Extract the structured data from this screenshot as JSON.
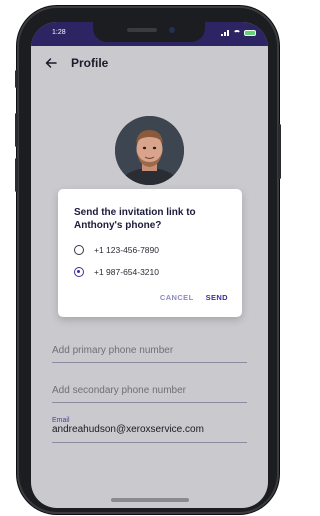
{
  "status": {
    "time": "1:28"
  },
  "header": {
    "title": "Profile"
  },
  "fields": {
    "primary_placeholder": "Add primary phone number",
    "secondary_placeholder": "Add secondary phone number",
    "email_label": "Email",
    "email_value": "andreahudson@xeroxservice.com"
  },
  "dialog": {
    "title": "Send the invitation link to Anthony's phone?",
    "options": [
      {
        "label": "+1 123-456-7890",
        "selected": false
      },
      {
        "label": "+1 987-654-3210",
        "selected": true
      }
    ],
    "cancel_label": "CANCEL",
    "send_label": "SEND"
  },
  "colors": {
    "accent": "#3b2f9a",
    "status_bar": "#2c2463",
    "battery": "#66d17a"
  }
}
